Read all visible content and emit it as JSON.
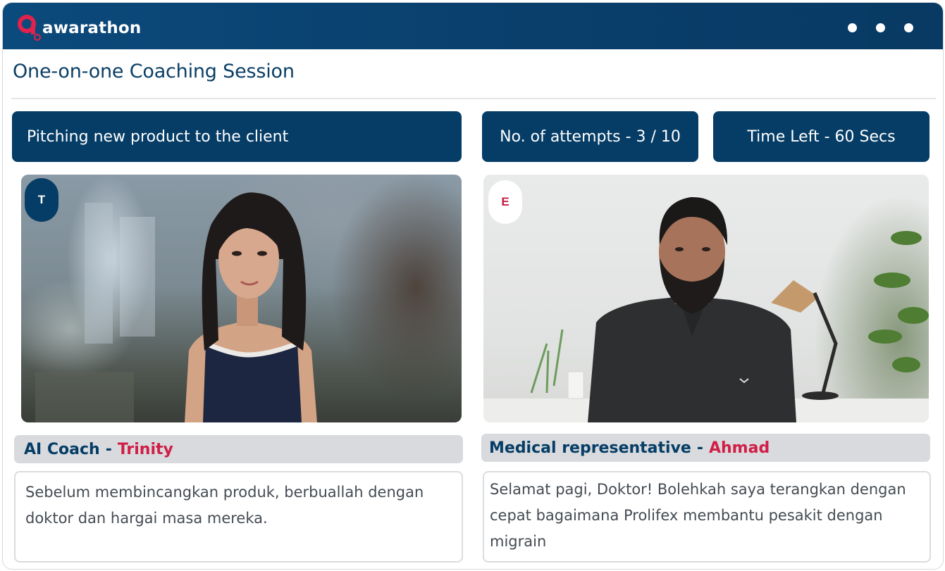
{
  "app": {
    "logo_text": "awarathon",
    "brand_color": "#063d66",
    "accent_color": "#d01e47",
    "menu_icon": "more-dots-icon"
  },
  "page": {
    "title": "One-on-one Coaching Session"
  },
  "session": {
    "scenario": "Pitching new product to the client",
    "attempts": "No. of attempts - 3 / 10",
    "time_left": "Time Left - 60 Secs"
  },
  "coach": {
    "badge": "T",
    "role": "AI Coach",
    "separator": "-",
    "name": "Trinity",
    "message": "Sebelum membincangkan produk, berbuallah dengan doktor dan hargai masa mereka."
  },
  "rep": {
    "badge": "E",
    "role": "Medical representative",
    "separator": "-",
    "name": "Ahmad",
    "message": "Selamat pagi, Doktor! Bolehkah saya terangkan dengan cepat bagaimana Prolifex membantu pesakit dengan migrain"
  }
}
